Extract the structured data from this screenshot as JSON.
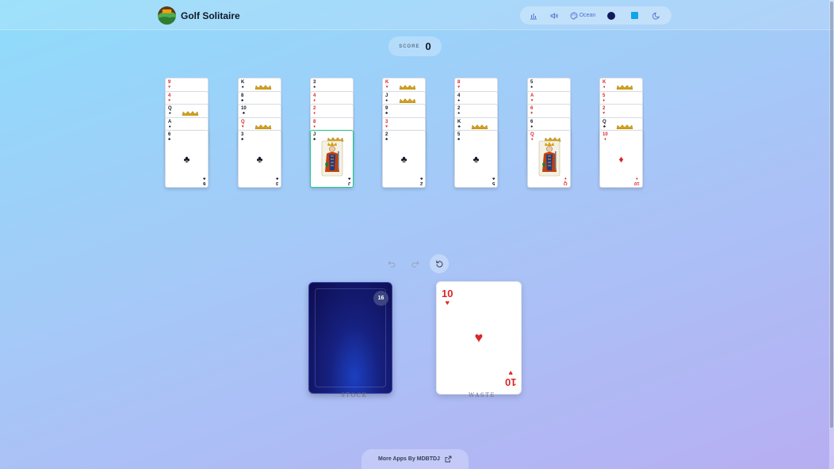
{
  "header": {
    "title": "Golf Solitaire",
    "theme_label": "Ocean"
  },
  "score": {
    "label": "SCORE",
    "value": "0"
  },
  "tableau": [
    [
      {
        "rank": "9",
        "suit": "♥",
        "color": "red"
      },
      {
        "rank": "4",
        "suit": "♥",
        "color": "red"
      },
      {
        "rank": "Q",
        "suit": "♠",
        "color": "black",
        "face": true
      },
      {
        "rank": "A",
        "suit": "♠",
        "color": "black"
      },
      {
        "rank": "6",
        "suit": "♣",
        "color": "black"
      }
    ],
    [
      {
        "rank": "K",
        "suit": "♠",
        "color": "black",
        "face": true
      },
      {
        "rank": "8",
        "suit": "♣",
        "color": "black"
      },
      {
        "rank": "10",
        "suit": "♣",
        "color": "black"
      },
      {
        "rank": "Q",
        "suit": "♥",
        "color": "red",
        "face": true
      },
      {
        "rank": "3",
        "suit": "♣",
        "color": "black"
      }
    ],
    [
      {
        "rank": "3",
        "suit": "♠",
        "color": "black"
      },
      {
        "rank": "4",
        "suit": "♦",
        "color": "red"
      },
      {
        "rank": "2",
        "suit": "♦",
        "color": "red"
      },
      {
        "rank": "8",
        "suit": "♦",
        "color": "red"
      },
      {
        "rank": "J",
        "suit": "♣",
        "color": "black",
        "face": true,
        "highlight": true
      }
    ],
    [
      {
        "rank": "K",
        "suit": "♥",
        "color": "red",
        "face": true
      },
      {
        "rank": "J",
        "suit": "♠",
        "color": "black",
        "face": true
      },
      {
        "rank": "9",
        "suit": "♣",
        "color": "black"
      },
      {
        "rank": "3",
        "suit": "♥",
        "color": "red"
      },
      {
        "rank": "2",
        "suit": "♣",
        "color": "black"
      }
    ],
    [
      {
        "rank": "8",
        "suit": "♥",
        "color": "red"
      },
      {
        "rank": "4",
        "suit": "♠",
        "color": "black"
      },
      {
        "rank": "2",
        "suit": "♠",
        "color": "black"
      },
      {
        "rank": "K",
        "suit": "♣",
        "color": "black",
        "face": true
      },
      {
        "rank": "5",
        "suit": "♣",
        "color": "black"
      }
    ],
    [
      {
        "rank": "5",
        "suit": "♠",
        "color": "black"
      },
      {
        "rank": "A",
        "suit": "♥",
        "color": "red"
      },
      {
        "rank": "6",
        "suit": "♥",
        "color": "red"
      },
      {
        "rank": "6",
        "suit": "♠",
        "color": "black"
      },
      {
        "rank": "Q",
        "suit": "♦",
        "color": "red",
        "face": true
      }
    ],
    [
      {
        "rank": "K",
        "suit": "♦",
        "color": "red",
        "face": true
      },
      {
        "rank": "5",
        "suit": "♦",
        "color": "red"
      },
      {
        "rank": "2",
        "suit": "♥",
        "color": "red"
      },
      {
        "rank": "Q",
        "suit": "♣",
        "color": "black",
        "face": true
      },
      {
        "rank": "10",
        "suit": "♦",
        "color": "red"
      }
    ]
  ],
  "stock": {
    "count": "16",
    "label": "STOCK"
  },
  "waste": {
    "rank": "10",
    "suit": "♥",
    "label": "WASTE"
  },
  "footer": {
    "more_apps": "More Apps By MDBTDJ"
  }
}
